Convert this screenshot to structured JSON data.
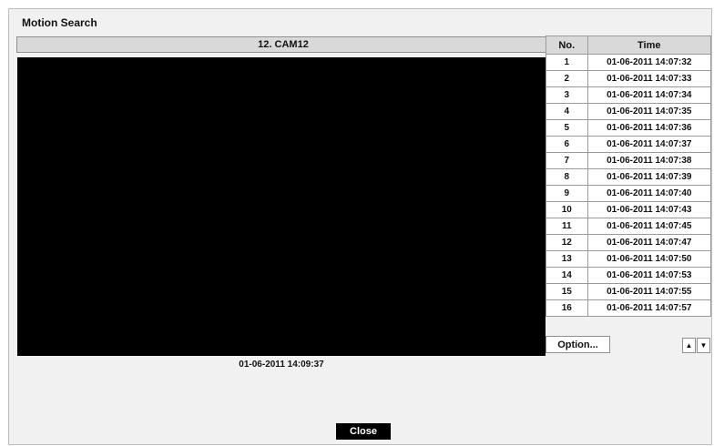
{
  "dialog": {
    "title": "Motion Search"
  },
  "camera": {
    "header": "12. CAM12",
    "timestamp": "01-06-2011  14:09:37"
  },
  "table": {
    "headers": {
      "no": "No.",
      "time": "Time"
    },
    "rows": [
      {
        "no": "1",
        "time": "01-06-2011  14:07:32"
      },
      {
        "no": "2",
        "time": "01-06-2011  14:07:33"
      },
      {
        "no": "3",
        "time": "01-06-2011  14:07:34"
      },
      {
        "no": "4",
        "time": "01-06-2011  14:07:35"
      },
      {
        "no": "5",
        "time": "01-06-2011  14:07:36"
      },
      {
        "no": "6",
        "time": "01-06-2011  14:07:37"
      },
      {
        "no": "7",
        "time": "01-06-2011  14:07:38"
      },
      {
        "no": "8",
        "time": "01-06-2011  14:07:39"
      },
      {
        "no": "9",
        "time": "01-06-2011  14:07:40"
      },
      {
        "no": "10",
        "time": "01-06-2011  14:07:43"
      },
      {
        "no": "11",
        "time": "01-06-2011  14:07:45"
      },
      {
        "no": "12",
        "time": "01-06-2011  14:07:47"
      },
      {
        "no": "13",
        "time": "01-06-2011  14:07:50"
      },
      {
        "no": "14",
        "time": "01-06-2011  14:07:53"
      },
      {
        "no": "15",
        "time": "01-06-2011  14:07:55"
      },
      {
        "no": "16",
        "time": "01-06-2011  14:07:57"
      }
    ]
  },
  "controls": {
    "option_label": "Option...",
    "up_icon": "▲",
    "down_icon": "▼",
    "close_label": "Close"
  }
}
